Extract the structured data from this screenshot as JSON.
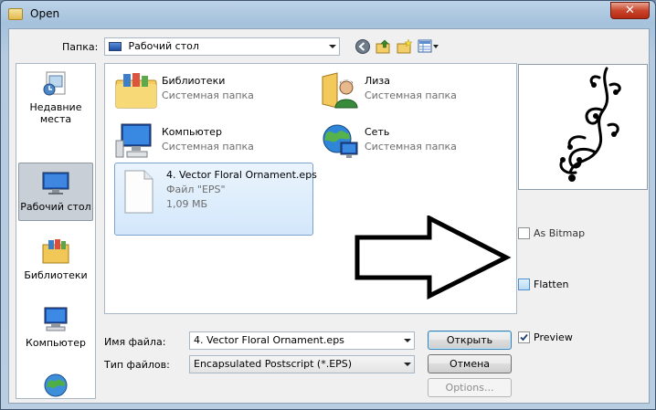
{
  "window": {
    "title": "Open",
    "close_glyph": "✕"
  },
  "toolbar": {
    "folder_label": "Папка:",
    "folder_value": "Рабочий стол",
    "icons": [
      "back-icon",
      "up-folder-icon",
      "new-folder-icon",
      "view-menu-icon"
    ]
  },
  "places": [
    {
      "label": "Недавние места",
      "icon": "recent-places-icon",
      "selected": false
    },
    {
      "label": "Рабочий стол",
      "icon": "desktop-icon",
      "selected": true
    },
    {
      "label": "Библиотеки",
      "icon": "libraries-icon",
      "selected": false
    },
    {
      "label": "Компьютер",
      "icon": "computer-icon",
      "selected": false
    },
    {
      "label": "",
      "icon": "network-icon",
      "selected": false
    }
  ],
  "files": [
    {
      "name": "Библиотеки",
      "type": "Системная папка",
      "icon": "libraries-folder-icon"
    },
    {
      "name": "Лиза",
      "type": "Системная папка",
      "icon": "user-folder-icon"
    },
    {
      "name": "Компьютер",
      "type": "Системная папка",
      "icon": "computer-icon"
    },
    {
      "name": "Сеть",
      "type": "Системная папка",
      "icon": "network-globe-icon"
    },
    {
      "name": "4. Vector Floral Ornament.eps",
      "type": "Файл \"EPS\"",
      "size": "1,09 МБ",
      "icon": "eps-file-icon",
      "selected": true
    }
  ],
  "form": {
    "filename_label": "Имя файла:",
    "filename_value": "4. Vector Floral Ornament.eps",
    "filetype_label": "Тип файлов:",
    "filetype_value": "Encapsulated Postscript (*.EPS)"
  },
  "buttons": {
    "open": "Открыть",
    "cancel": "Отмена",
    "options": "Options..."
  },
  "options": {
    "as_bitmap": {
      "label": "As Bitmap",
      "checked": false
    },
    "flatten": {
      "label": "Flatten",
      "checked": false
    },
    "preview": {
      "label": "Preview",
      "checked": true
    }
  },
  "annotation": {
    "arrow_direction": "right"
  },
  "colors": {
    "selection": "#d3e7fb",
    "window_frame": "#a5c1dc",
    "close_button": "#c9452c"
  }
}
